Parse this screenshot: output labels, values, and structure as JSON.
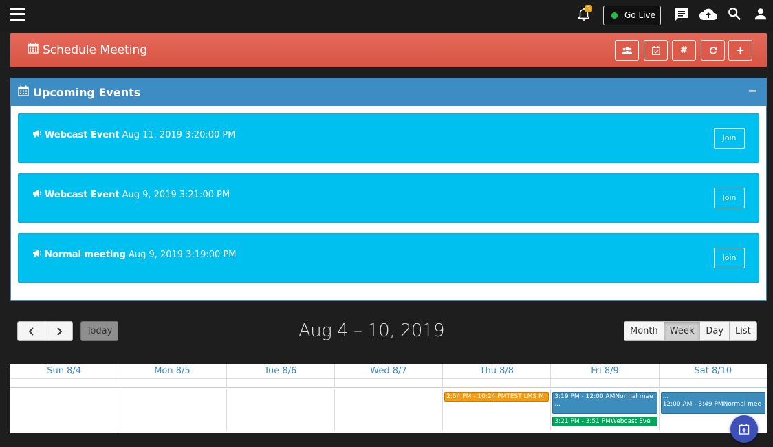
{
  "topbar": {
    "notification_count": "3",
    "go_live_label": "Go Live",
    "icons": [
      "menu-icon",
      "bell-icon",
      "chat-icon",
      "cloud-upload-icon",
      "search-icon",
      "user-icon"
    ]
  },
  "schedule": {
    "title": "Schedule Meeting",
    "buttons": [
      "group-icon",
      "calendar-icon",
      "hashtag-icon",
      "refresh-icon",
      "plus-icon"
    ]
  },
  "upcoming": {
    "title": "Upcoming Events",
    "collapse_label": "−",
    "events": [
      {
        "type": "Webcast Event",
        "datetime": "Aug 11, 2019 3:20:00 PM",
        "action": "Join"
      },
      {
        "type": "Webcast Event",
        "datetime": "Aug 9, 2019 3:21:00 PM",
        "action": "Join"
      },
      {
        "type": "Normal meeting",
        "datetime": "Aug 9, 2019 3:19:00 PM",
        "action": "Join"
      }
    ]
  },
  "calendar": {
    "today_label": "Today",
    "range_title": "Aug 4 – 10, 2019",
    "views": [
      "Month",
      "Week",
      "Day",
      "List"
    ],
    "active_view": "Week",
    "days": [
      "Sun 8/4",
      "Mon 8/5",
      "Tue 8/6",
      "Wed 8/7",
      "Thu 8/8",
      "Fri 8/9",
      "Sat 8/10"
    ],
    "events": {
      "thu": "2:54 PM - 10:24 PMTEST LMS M",
      "fri_1": "3:19 PM - 12:00 AMNormal mee",
      "fri_1b": "...",
      "fri_2": "3:21 PM - 3:51 PMWebcast Eve",
      "sat_1a": "...",
      "sat_1b": "12:00 AM - 3:49 PMNormal mee"
    }
  },
  "colors": {
    "schedule_bar": "#d95444",
    "panel_header": "#3d8cc4",
    "event_card": "#00c0ef",
    "event_orange": "#f39c12",
    "event_blue": "#3c8dbc",
    "event_green": "#00a65a"
  }
}
